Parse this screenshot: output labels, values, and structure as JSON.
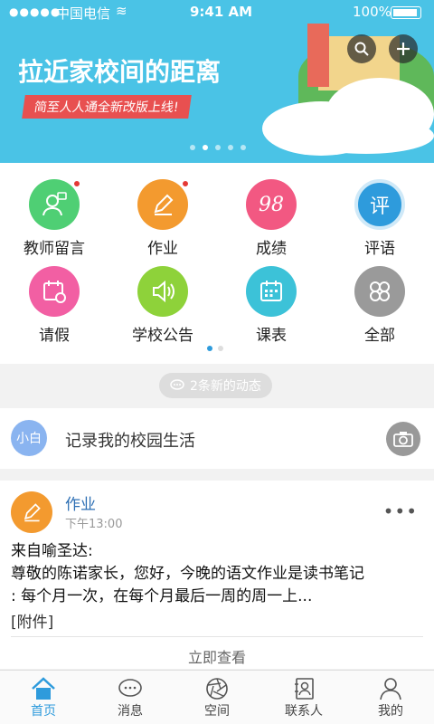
{
  "status_bar": {
    "signal": "●●●●●",
    "carrier": "中国电信",
    "wifi": "≋",
    "time": "9:41 AM",
    "battery": "100%"
  },
  "banner": {
    "title": "拉近家校间的距离",
    "subtitle": "简至人人通全新改版上线!"
  },
  "grid": {
    "items": [
      {
        "label": "教师留言",
        "color": "#4fcf74",
        "icon": "teacher-message-icon",
        "badge": true
      },
      {
        "label": "作业",
        "color": "#f39a2f",
        "icon": "homework-pencil-icon",
        "badge": true
      },
      {
        "label": "成绩",
        "color": "#f25882",
        "icon": "grade-icon",
        "glyph": "98",
        "badge": false
      },
      {
        "label": "评语",
        "color": "#2e9bdc",
        "icon": "comment-icon",
        "glyph": "评",
        "badge": false
      },
      {
        "label": "请假",
        "color": "#f25fa3",
        "icon": "leave-calendar-icon",
        "badge": false
      },
      {
        "label": "学校公告",
        "color": "#8ed23a",
        "icon": "announcement-speaker-icon",
        "badge": false
      },
      {
        "label": "课表",
        "color": "#3cc2d8",
        "icon": "schedule-calendar-icon",
        "badge": false
      },
      {
        "label": "全部",
        "color": "#9a9a9a",
        "icon": "all-clover-icon",
        "badge": false
      }
    ]
  },
  "feed": {
    "new_updates": "2条新的动态",
    "record_avatar": "小白",
    "record_prompt": "记录我的校园生活",
    "post": {
      "title": "作业",
      "time": "下午13:00",
      "line1": "来自喻圣达:",
      "line2": "尊敬的陈诺家长，您好，今晚的语文作业是读书笔记",
      "line3": ": 每个月一次，在每个月最后一周的周一上...",
      "attachment": "[附件]",
      "view_now": "立即查看",
      "more": "•••"
    }
  },
  "tabbar": {
    "tabs": [
      {
        "label": "首页",
        "icon": "home-icon",
        "active": true
      },
      {
        "label": "消息",
        "icon": "message-bubble-icon",
        "active": false
      },
      {
        "label": "空间",
        "icon": "aperture-icon",
        "active": false
      },
      {
        "label": "联系人",
        "icon": "contacts-icon",
        "active": false
      },
      {
        "label": "我的",
        "icon": "person-icon",
        "active": false
      }
    ]
  },
  "colors": {
    "accent": "#2e9bdc",
    "banner_bg": "#4ac3e6",
    "badge": "#e53935"
  }
}
